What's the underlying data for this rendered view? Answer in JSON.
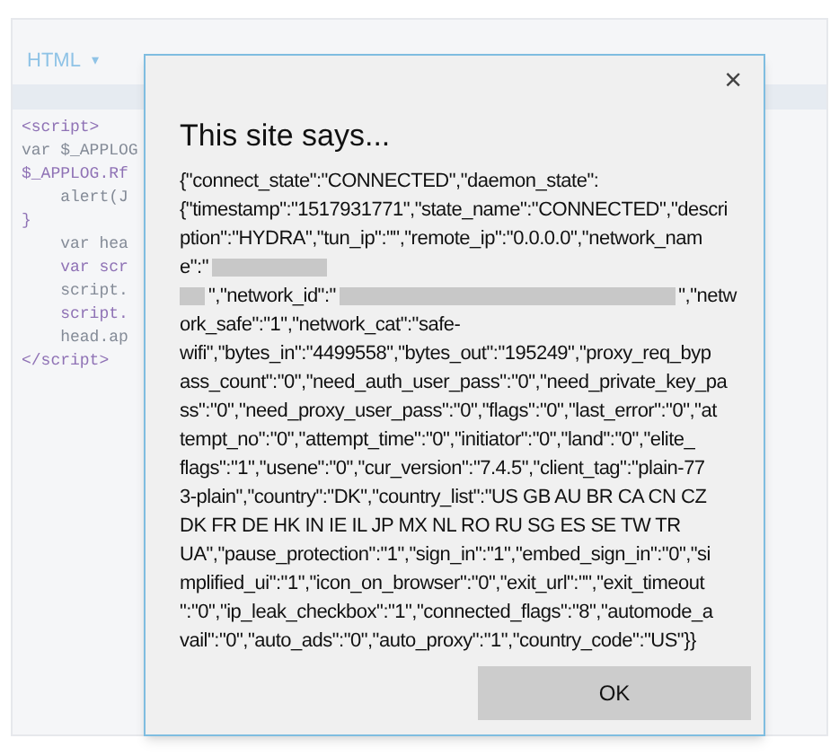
{
  "editor": {
    "language_menu": {
      "label": "HTML",
      "caret": "▾"
    },
    "code_lines": [
      "<script>",
      "var $_APPLOG",
      "$_APPLOG.Rf",
      "    alert(J",
      "}",
      "    var hea",
      "    var scr",
      "    script.",
      "    script.",
      "    head.ap",
      "</script>"
    ]
  },
  "dialog": {
    "close": "×",
    "title": "This site says...",
    "message_lines": [
      [
        {
          "kind": "text",
          "text": "{\"connect_state\":\"CONNECTED\",\"daemon_state\":"
        }
      ],
      [
        {
          "kind": "text",
          "text": "{\"timestamp\":\"1517931771\",\"state_name\":\"CONNECTED\",\"descri"
        }
      ],
      [
        {
          "kind": "text",
          "text": "ption\":\"HYDRA\",\"tun_ip\":\"\",\"remote_ip\":\"0.0.0.0\",\"network_nam"
        }
      ],
      [
        {
          "kind": "text",
          "text": "e\":\""
        },
        {
          "kind": "redacted"
        }
      ],
      [
        {
          "kind": "redacted"
        },
        {
          "kind": "text",
          "text": "\",\"network_id\":\""
        },
        {
          "kind": "redacted"
        },
        {
          "kind": "text",
          "text": "\",\"netw"
        }
      ],
      [
        {
          "kind": "text",
          "text": "ork_safe\":\"1\",\"network_cat\":\"safe-"
        }
      ],
      [
        {
          "kind": "text",
          "text": "wifi\",\"bytes_in\":\"4499558\",\"bytes_out\":\"195249\",\"proxy_req_byp"
        }
      ],
      [
        {
          "kind": "text",
          "text": "ass_count\":\"0\",\"need_auth_user_pass\":\"0\",\"need_private_key_pa"
        }
      ],
      [
        {
          "kind": "text",
          "text": "ss\":\"0\",\"need_proxy_user_pass\":\"0\",\"flags\":\"0\",\"last_error\":\"0\",\"at"
        }
      ],
      [
        {
          "kind": "text",
          "text": "tempt_no\":\"0\",\"attempt_time\":\"0\",\"initiator\":\"0\",\"land\":\"0\",\"elite_"
        }
      ],
      [
        {
          "kind": "text",
          "text": "flags\":\"1\",\"usene\":\"0\",\"cur_version\":\"7.4.5\",\"client_tag\":\"plain-77"
        }
      ],
      [
        {
          "kind": "text",
          "text": "3-plain\",\"country\":\"DK\",\"country_list\":\"US GB AU BR CA CN CZ"
        }
      ],
      [
        {
          "kind": "text",
          "text": "DK FR DE HK IN IE IL JP MX NL RO RU SG ES SE TW TR"
        }
      ],
      [
        {
          "kind": "text",
          "text": "UA\",\"pause_protection\":\"1\",\"sign_in\":\"1\",\"embed_sign_in\":\"0\",\"si"
        }
      ],
      [
        {
          "kind": "text",
          "text": "mplified_ui\":\"1\",\"icon_on_browser\":\"0\",\"exit_url\":\"\",\"exit_timeout"
        }
      ],
      [
        {
          "kind": "text",
          "text": "\":\"0\",\"ip_leak_checkbox\":\"1\",\"connected_flags\":\"8\",\"automode_a"
        }
      ],
      [
        {
          "kind": "text",
          "text": "vail\":\"0\",\"auto_ads\":\"0\",\"auto_proxy\":\"1\",\"country_code\":\"US\"}}"
        }
      ]
    ],
    "button": "OK"
  }
}
